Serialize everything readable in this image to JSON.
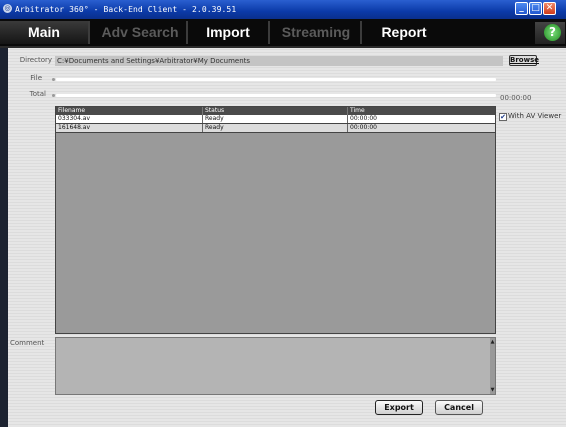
{
  "window": {
    "title": "Arbitrator 360°  -  Back-End Client  -  2.0.39.51",
    "app_icon": "app-globe-icon"
  },
  "nav": {
    "tabs": [
      {
        "label": "Main",
        "active": true
      },
      {
        "label": "Adv Search",
        "active": false
      },
      {
        "label": "Import",
        "active": false
      },
      {
        "label": "Streaming",
        "active": false
      },
      {
        "label": "Report",
        "active": false
      }
    ],
    "help_glyph": "?"
  },
  "form": {
    "directory_label": "Directory",
    "directory_value": "C:¥Documents and Settings¥Arbitrator¥My Documents",
    "browse_label": "Browse",
    "file_label": "File",
    "total_label": "Total",
    "total_time": "00:00:00",
    "with_av_viewer_label": "With AV Viewer",
    "with_av_viewer_checked": true,
    "comment_label": "Comment",
    "comment_value": ""
  },
  "table": {
    "columns": [
      "Filename",
      "Status",
      "Time"
    ],
    "rows": [
      {
        "filename": "033304.av",
        "status": "Ready",
        "time": "00:00:00"
      },
      {
        "filename": "161648.av",
        "status": "Ready",
        "time": "00:00:00"
      }
    ]
  },
  "actions": {
    "export_label": "Export",
    "cancel_label": "Cancel"
  },
  "colors": {
    "titlebar": "#0b3aa8",
    "nav_bg": "#0a0a0a",
    "content_bg": "#e6e6e6",
    "help_green": "#1e8a1e"
  }
}
